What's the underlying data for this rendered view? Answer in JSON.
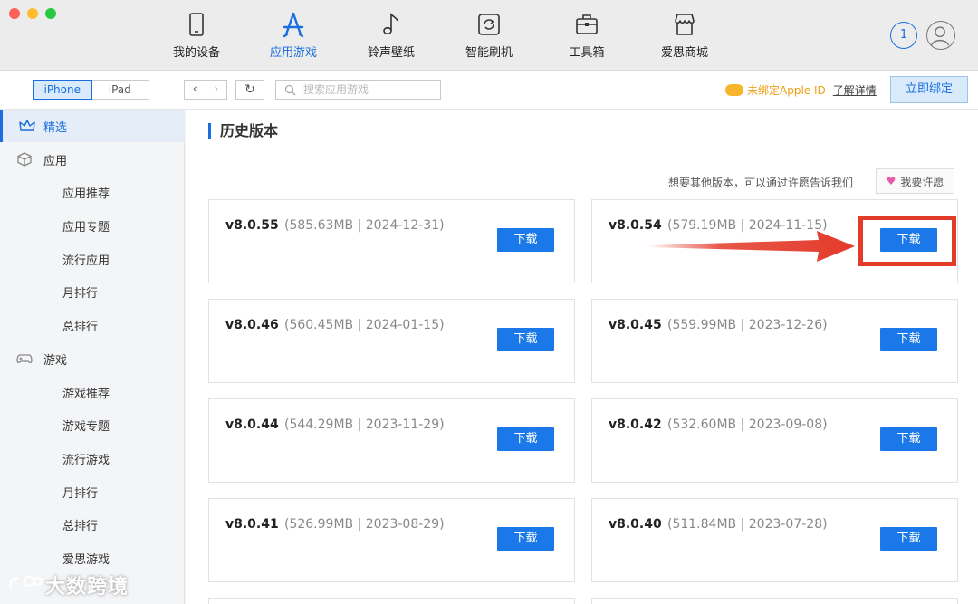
{
  "top_nav": [
    {
      "label": "我的设备",
      "icon": "phone-icon"
    },
    {
      "label": "应用游戏",
      "icon": "app-store-icon",
      "active": true
    },
    {
      "label": "铃声壁纸",
      "icon": "music-note-icon"
    },
    {
      "label": "智能刷机",
      "icon": "flash-refresh-icon"
    },
    {
      "label": "工具箱",
      "icon": "toolbox-icon"
    },
    {
      "label": "爱思商城",
      "icon": "store-icon"
    }
  ],
  "download_count": "1",
  "device_tabs": {
    "iphone": "iPhone",
    "ipad": "iPad",
    "selected": "iPhone"
  },
  "search": {
    "placeholder": "搜索应用游戏"
  },
  "apple_id": {
    "notice": "未绑定Apple ID",
    "link": "了解详情",
    "bind_button": "立即绑定"
  },
  "sidebar": {
    "featured": "精选",
    "apps": "应用",
    "app_items": [
      "应用推荐",
      "应用专题",
      "流行应用",
      "月排行",
      "总排行"
    ],
    "games": "游戏",
    "game_items": [
      "游戏推荐",
      "游戏专题",
      "流行游戏",
      "月排行",
      "总排行",
      "爱思游戏"
    ]
  },
  "main": {
    "section_title": "历史版本",
    "wish_hint": "想要其他版本，可以通过许愿告诉我们",
    "wish_button": "我要许愿",
    "download_label": "下载"
  },
  "versions": [
    {
      "version": "v8.0.55",
      "meta": "(585.63MB | 2024-12-31)"
    },
    {
      "version": "v8.0.54",
      "meta": "(579.19MB | 2024-11-15)"
    },
    {
      "version": "v8.0.46",
      "meta": "(560.45MB | 2024-01-15)"
    },
    {
      "version": "v8.0.45",
      "meta": "(559.99MB | 2023-12-26)"
    },
    {
      "version": "v8.0.44",
      "meta": "(544.29MB | 2023-11-29)"
    },
    {
      "version": "v8.0.42",
      "meta": "(532.60MB | 2023-09-08)"
    },
    {
      "version": "v8.0.41",
      "meta": "(526.99MB | 2023-08-29)"
    },
    {
      "version": "v8.0.40",
      "meta": "(511.84MB | 2023-07-28)"
    }
  ],
  "watermark": "大数跨境",
  "colors": {
    "accent": "#1a6ee0",
    "download": "#1a78e8",
    "highlight": "#e33a2a",
    "warning": "#f0a018"
  }
}
